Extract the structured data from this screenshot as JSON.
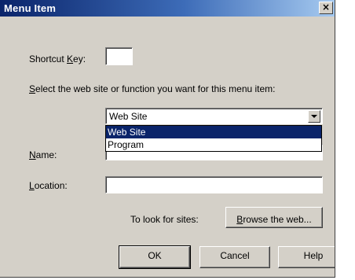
{
  "window": {
    "title": "Menu Item",
    "close_glyph": "×"
  },
  "shortcut": {
    "label_pre": "Shortcut ",
    "label_key": "K",
    "label_post": "ey:",
    "value": ""
  },
  "select_prompt": {
    "key": "S",
    "rest": "elect the web site or function you want for this menu item:"
  },
  "function_select": {
    "value": "Web Site",
    "options": [
      "Web Site",
      "Program"
    ],
    "highlighted": "Web Site"
  },
  "name": {
    "key": "N",
    "rest": "ame:",
    "value": ""
  },
  "location": {
    "key": "L",
    "rest": "ocation:",
    "value": ""
  },
  "browse": {
    "prompt": "To look for sites:",
    "button_key": "B",
    "button_rest": "rowse the web..."
  },
  "buttons": {
    "ok": "OK",
    "cancel": "Cancel",
    "help": "Help"
  }
}
